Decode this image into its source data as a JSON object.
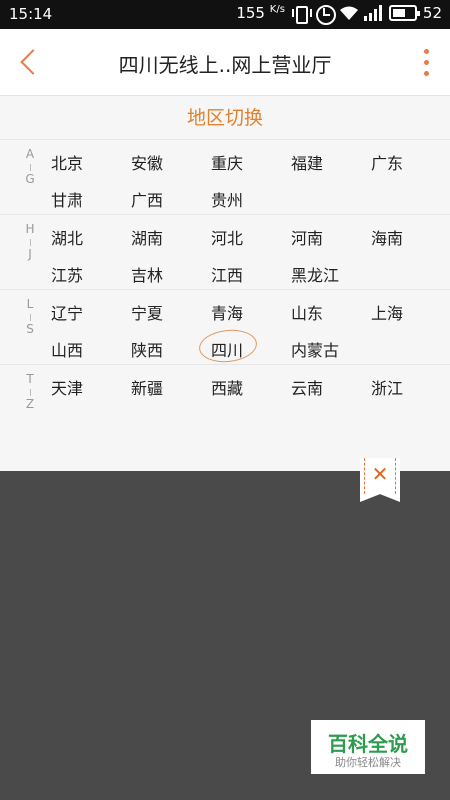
{
  "status_bar": {
    "time": "15:14",
    "speed": "155",
    "speed_unit": "K/s",
    "battery": "52"
  },
  "app_bar": {
    "title": "四川无线上..网上营业厅",
    "back_icon": "chevron-left-icon",
    "more_icon": "more-vertical-icon",
    "accent_color": "#e87a46"
  },
  "panel": {
    "title": "地区切换",
    "selected_city": "四川",
    "groups": [
      {
        "letters": [
          "A",
          "G"
        ],
        "cities": [
          "北京",
          "安徽",
          "重庆",
          "福建",
          "广东",
          "甘肃",
          "广西",
          "贵州"
        ]
      },
      {
        "letters": [
          "H",
          "J"
        ],
        "cities": [
          "湖北",
          "湖南",
          "河北",
          "河南",
          "海南",
          "江苏",
          "吉林",
          "江西",
          "黑龙江"
        ]
      },
      {
        "letters": [
          "L",
          "S"
        ],
        "cities": [
          "辽宁",
          "宁夏",
          "青海",
          "山东",
          "上海",
          "山西",
          "陕西",
          "四川",
          "内蒙古"
        ]
      },
      {
        "letters": [
          "T",
          "Z"
        ],
        "cities": [
          "天津",
          "新疆",
          "西藏",
          "云南",
          "浙江"
        ]
      }
    ]
  },
  "close_tab": {
    "label": "✕"
  },
  "watermark": {
    "main": "百科全说",
    "sub": "助你轻松解决"
  }
}
